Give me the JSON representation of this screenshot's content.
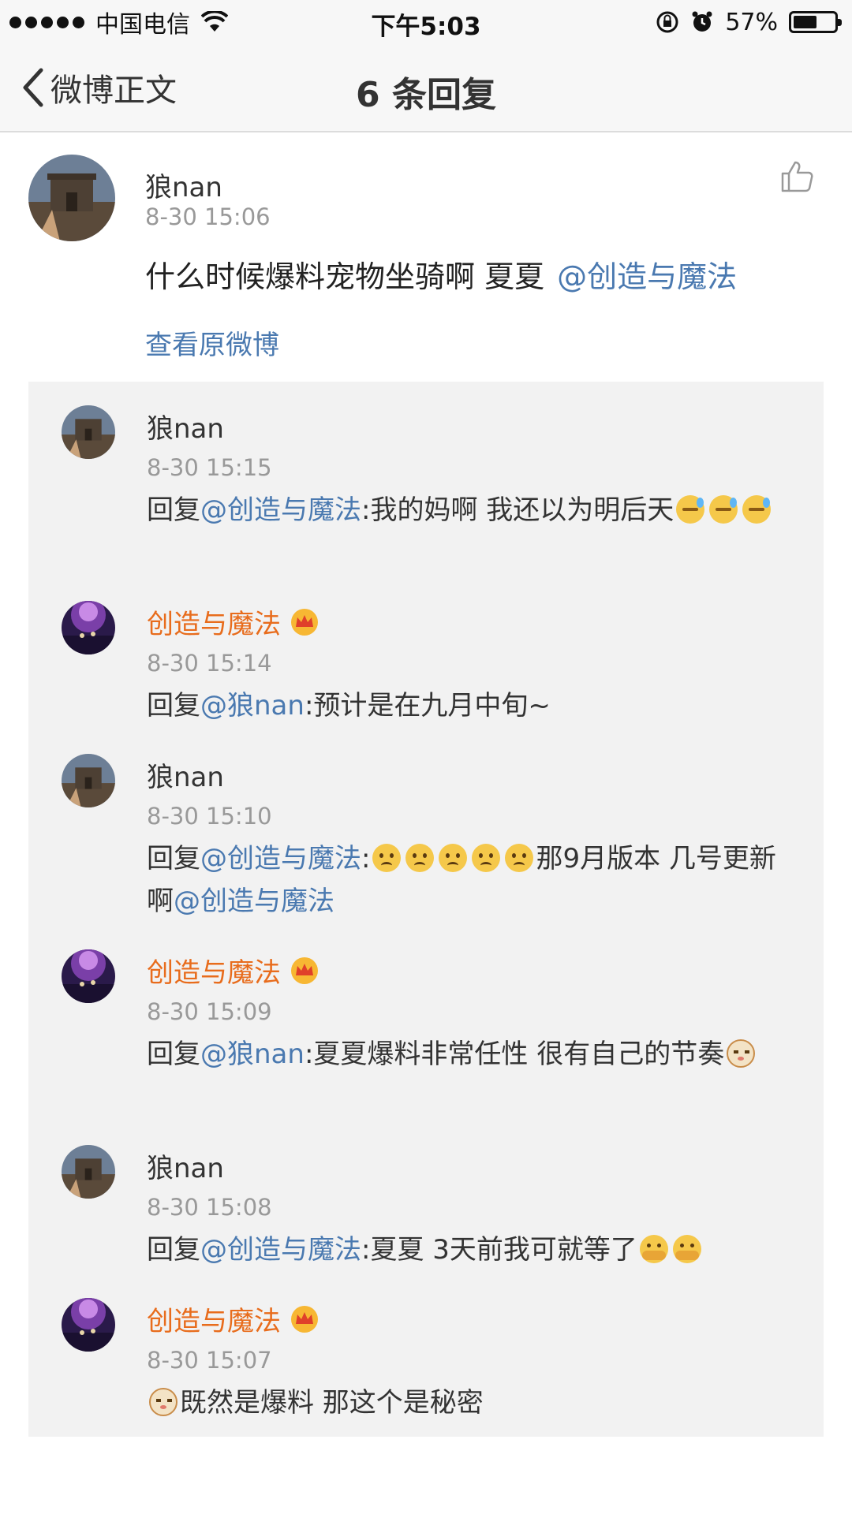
{
  "status_bar": {
    "carrier": "中国电信",
    "time": "下午5:03",
    "battery_percent": "57%",
    "battery_level": 0.57
  },
  "nav": {
    "back_label": "微博正文",
    "title": "6 条回复"
  },
  "main_comment": {
    "author": "狼nan",
    "time": "8-30 15:06",
    "text": "什么时候爆料宠物坐骑啊  夏夏",
    "mention": "@创造与魔法",
    "view_original": "查看原微博"
  },
  "replies": [
    {
      "author": "狼nan",
      "vip": false,
      "time": "8-30 15:15",
      "prefix": "回复",
      "mention": "@创造与魔法",
      "text": ":我的妈啊   我还以为明后天",
      "emojis": [
        "sweat",
        "sweat",
        "sweat"
      ]
    },
    {
      "author": "创造与魔法",
      "vip": true,
      "time": "8-30 15:14",
      "prefix": "回复",
      "mention": "@狼nan",
      "text": ":预计是在九月中旬~"
    },
    {
      "author": "狼nan",
      "vip": false,
      "time": "8-30 15:10",
      "prefix": "回复",
      "mention": "@创造与魔法",
      "text_before": ":",
      "emojis": [
        "sad",
        "sad",
        "sad",
        "sad",
        "sad"
      ],
      "text": "那9月版本  几号更新啊",
      "mention2": "@创造与魔法"
    },
    {
      "author": "创造与魔法",
      "vip": true,
      "time": "8-30 15:09",
      "prefix": "回复",
      "mention": "@狼nan",
      "text": ":夏夏爆料非常任性 很有自己的节奏",
      "emojis": [
        "cat"
      ]
    },
    {
      "author": "狼nan",
      "vip": false,
      "time": "8-30 15:08",
      "prefix": "回复",
      "mention": "@创造与魔法",
      "text": ":夏夏  3天前我可就等了",
      "emojis": [
        "hug",
        "hug"
      ]
    },
    {
      "author": "创造与魔法",
      "vip": true,
      "time": "8-30 15:07",
      "emojis": [
        "cat"
      ],
      "text": "既然是爆料 那这个是秘密"
    }
  ]
}
